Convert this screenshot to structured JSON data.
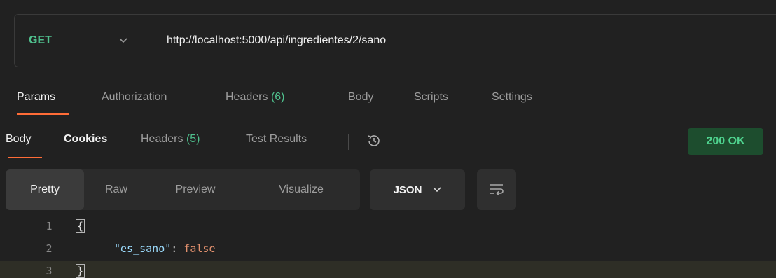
{
  "request": {
    "method": "GET",
    "url": "http://localhost:5000/api/ingredientes/2/sano"
  },
  "request_tabs": [
    {
      "label": "Params",
      "active": true
    },
    {
      "label": "Authorization"
    },
    {
      "label": "Headers",
      "count": "(6)"
    },
    {
      "label": "Body"
    },
    {
      "label": "Scripts"
    },
    {
      "label": "Settings"
    }
  ],
  "response_tabs": [
    {
      "label": "Body",
      "active": true
    },
    {
      "label": "Cookies"
    },
    {
      "label": "Headers",
      "count": "(5)"
    },
    {
      "label": "Test Results"
    }
  ],
  "history_icon": "history-icon",
  "status": {
    "label": "200 OK",
    "color": "#4fd38f"
  },
  "view_modes": [
    "Pretty",
    "Raw",
    "Preview",
    "Visualize"
  ],
  "active_view": "Pretty",
  "format": {
    "label": "JSON"
  },
  "wrap_icon": "wrap-lines-icon",
  "code": {
    "line_numbers": [
      "1",
      "2",
      "3"
    ],
    "open_brace": "{",
    "close_brace": "}",
    "key": "\"es_sano\"",
    "colon": ": ",
    "value": "false"
  },
  "colors": {
    "accent": "#ff6c37",
    "method": "#4fc08d",
    "json_key": "#9cdcfe",
    "json_value": "#e3916e"
  }
}
